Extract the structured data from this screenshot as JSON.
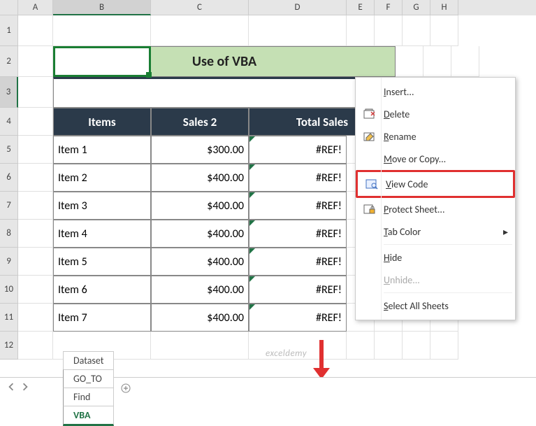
{
  "columns": [
    "A",
    "B",
    "C",
    "D",
    "E",
    "F",
    "G",
    "H"
  ],
  "rows": [
    "1",
    "2",
    "3",
    "4",
    "5",
    "6",
    "7",
    "8",
    "9",
    "10",
    "11",
    "12"
  ],
  "title": "Use of VBA",
  "table": {
    "headers": [
      "Items",
      "Sales 2",
      "Total Sales"
    ],
    "rows": [
      {
        "item": "Item 1",
        "sales": "$300.00",
        "total": "#REF!"
      },
      {
        "item": "Item 2",
        "sales": "$400.00",
        "total": "#REF!"
      },
      {
        "item": "Item 3",
        "sales": "$400.00",
        "total": "#REF!"
      },
      {
        "item": "Item 4",
        "sales": "$400.00",
        "total": "#REF!"
      },
      {
        "item": "Item 5",
        "sales": "$400.00",
        "total": "#REF!"
      },
      {
        "item": "Item 6",
        "sales": "$400.00",
        "total": "#REF!"
      },
      {
        "item": "Item 7",
        "sales": "$400.00",
        "total": "#REF!"
      }
    ]
  },
  "tabs": [
    {
      "label": "Dataset",
      "active": false
    },
    {
      "label": "GO_TO",
      "active": false
    },
    {
      "label": "Find",
      "active": false
    },
    {
      "label": "VBA",
      "active": true
    }
  ],
  "context_menu": {
    "items": [
      {
        "label_pre": "",
        "underline": "I",
        "label_post": "nsert...",
        "icon": "",
        "enabled": true
      },
      {
        "label_pre": "",
        "underline": "D",
        "label_post": "elete",
        "icon": "delete",
        "enabled": true
      },
      {
        "label_pre": "",
        "underline": "R",
        "label_post": "ename",
        "icon": "rename",
        "enabled": true
      },
      {
        "label_pre": "",
        "underline": "M",
        "label_post": "ove or Copy...",
        "icon": "",
        "enabled": true
      },
      {
        "label_pre": "",
        "underline": "V",
        "label_post": "iew Code",
        "icon": "viewcode",
        "enabled": true,
        "highlighted": true
      },
      {
        "label_pre": "",
        "underline": "P",
        "label_post": "rotect Sheet...",
        "icon": "protect",
        "enabled": true
      },
      {
        "label_pre": "",
        "underline": "T",
        "label_post": "ab Color",
        "icon": "",
        "enabled": true,
        "submenu": true
      },
      {
        "label_pre": "",
        "underline": "H",
        "label_post": "ide",
        "icon": "",
        "enabled": true
      },
      {
        "label_pre": "",
        "underline": "U",
        "label_post": "nhide...",
        "icon": "",
        "enabled": false
      },
      {
        "label_pre": "",
        "underline": "S",
        "label_post": "elect All Sheets",
        "icon": "",
        "enabled": true
      }
    ]
  },
  "watermark": "exceldemy"
}
